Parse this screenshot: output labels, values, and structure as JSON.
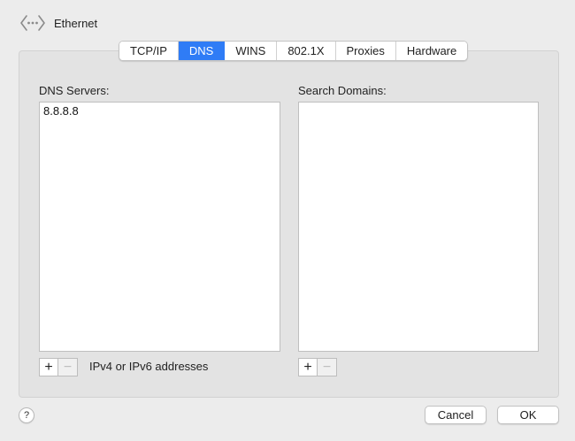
{
  "header": {
    "title": "Ethernet",
    "icon": "network-arrows-icon"
  },
  "tabs": [
    {
      "label": "TCP/IP",
      "active": false
    },
    {
      "label": "DNS",
      "active": true
    },
    {
      "label": "WINS",
      "active": false
    },
    {
      "label": "802.1X",
      "active": false
    },
    {
      "label": "Proxies",
      "active": false
    },
    {
      "label": "Hardware",
      "active": false
    }
  ],
  "dns": {
    "label": "DNS Servers:",
    "servers": [
      "8.8.8.8"
    ],
    "add_symbol": "+",
    "remove_symbol": "−",
    "hint": "IPv4 or IPv6 addresses"
  },
  "search": {
    "label": "Search Domains:",
    "domains": [],
    "add_symbol": "+",
    "remove_symbol": "−"
  },
  "footer": {
    "help_symbol": "?",
    "cancel_label": "Cancel",
    "ok_label": "OK"
  },
  "colors": {
    "accent": "#2f7cf6",
    "window_bg": "#ececec",
    "panel_bg": "#e3e3e3"
  }
}
